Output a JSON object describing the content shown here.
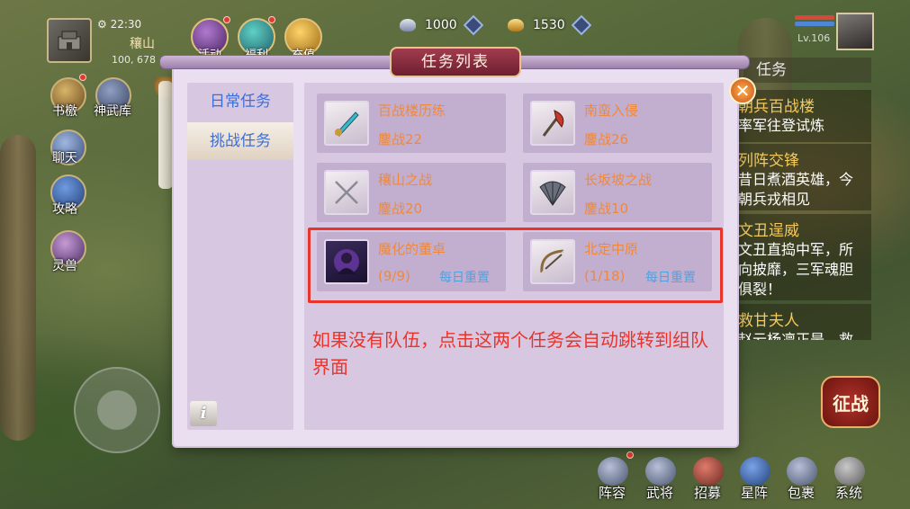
{
  "player": {
    "time": "22:30",
    "name": "穰山",
    "coords": "100, 678"
  },
  "top_icons": [
    {
      "label": "活动",
      "icon": "activity-orb-icon"
    },
    {
      "label": "福利",
      "icon": "welfare-icon"
    },
    {
      "label": "充值",
      "icon": "gold-ingot-icon"
    }
  ],
  "currency": {
    "silver": "1000",
    "gold": "1530"
  },
  "hero": {
    "level": "Lv.106"
  },
  "left_icons": [
    {
      "label": "书檄",
      "icon": "scroll-icon"
    },
    {
      "label": "神武库",
      "icon": "weapon-armory-icon"
    },
    {
      "label": "聊天",
      "icon": "chat-icon"
    },
    {
      "label": "攻略",
      "icon": "guide-book-icon"
    },
    {
      "label": "灵兽",
      "icon": "spirit-beast-icon"
    }
  ],
  "tracker": {
    "header": "任务",
    "items": [
      {
        "title": "朝兵百战楼",
        "desc": "率军往登试炼"
      },
      {
        "title": "列阵交锋",
        "desc": "昔日煮酒英雄，今朝兵戎相见"
      },
      {
        "title": "文丑逞威",
        "desc": "文丑直捣中军，所向披靡，三军魂胆俱裂！"
      },
      {
        "title": "救甘夫人",
        "desc": "赵云杨凛正是，救"
      }
    ]
  },
  "dialog": {
    "title": "任务列表",
    "close_label": "✕",
    "tabs": [
      {
        "label": "日常任务",
        "active": false
      },
      {
        "label": "挑战任务",
        "active": true
      }
    ],
    "info_label": "i",
    "quests": [
      {
        "name": "百战楼历练",
        "sub": "鏖战22",
        "reset": "",
        "icon": "blade-icon"
      },
      {
        "name": "南蛮入侵",
        "sub": "鏖战26",
        "reset": "",
        "icon": "battle-axe-icon"
      },
      {
        "name": "穰山之战",
        "sub": "鏖战20",
        "reset": "",
        "icon": "crossed-spears-icon"
      },
      {
        "name": "长坂坡之战",
        "sub": "鏖战10",
        "reset": "",
        "icon": "war-fan-icon"
      },
      {
        "name": "魔化的董卓",
        "sub": "(9/9)",
        "reset": "每日重置",
        "icon": "demon-boss-icon"
      },
      {
        "name": "北定中原",
        "sub": "(1/18)",
        "reset": "每日重置",
        "icon": "bow-icon"
      }
    ],
    "annotation": "如果没有队伍，点击这两个任务会自动跳转到组队界面"
  },
  "bottom_menu": [
    {
      "label": "阵容",
      "icon": "formation-icon"
    },
    {
      "label": "武将",
      "icon": "general-icon"
    },
    {
      "label": "招募",
      "icon": "recruit-icon"
    },
    {
      "label": "星阵",
      "icon": "star-array-icon"
    },
    {
      "label": "包裹",
      "icon": "bag-icon"
    },
    {
      "label": "系统",
      "icon": "gear-icon"
    }
  ],
  "fight_button": "征战",
  "colors": {
    "quest_text": "#f0883a",
    "reset_text": "#4ca3e4",
    "tab_text": "#3d6ed6",
    "annotation": "#e8342a",
    "tracker_title": "#f4c95b"
  }
}
